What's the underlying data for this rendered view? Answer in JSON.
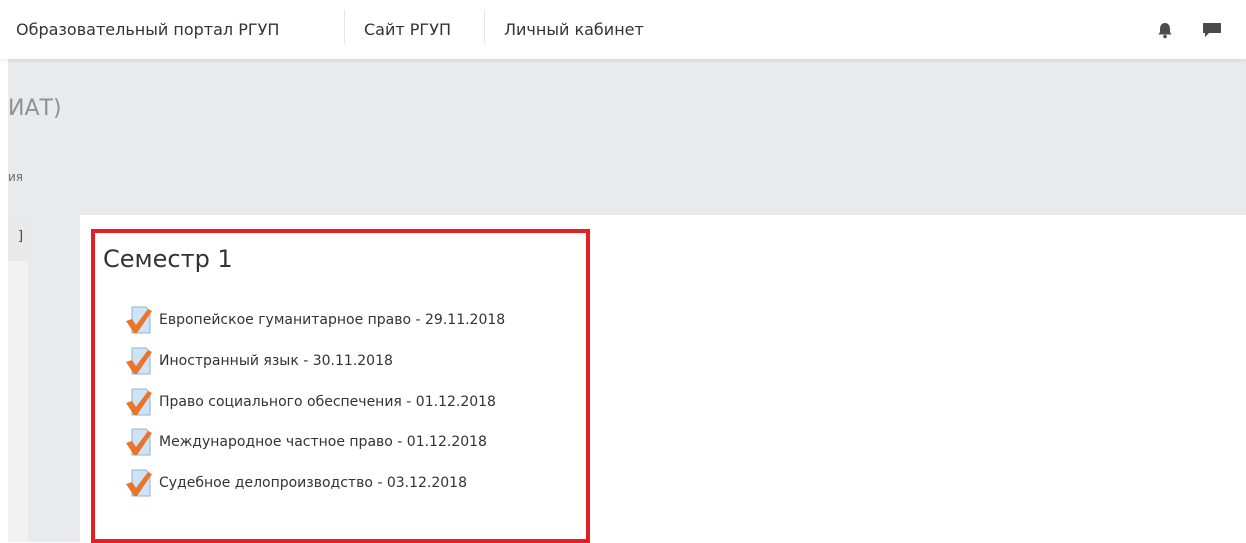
{
  "navbar": {
    "items": [
      {
        "label": "Образовательный портал РГУП"
      },
      {
        "label": "Сайт РГУП"
      },
      {
        "label": "Личный кабинет"
      }
    ],
    "icons": [
      "bell-icon",
      "chat-bubble-icon"
    ]
  },
  "header": {
    "title": "ИАТ)",
    "breadcrumb": "ия"
  },
  "left_panel": {
    "tab_glyph": "]"
  },
  "section": {
    "title": "Семестр 1",
    "activities": [
      {
        "label": "Европейское гуманитарное право - 29.11.2018"
      },
      {
        "label": "Иностранный язык - 30.11.2018"
      },
      {
        "label": "Право социального обеспечения - 01.12.2018"
      },
      {
        "label": "Международное частное право - 01.12.2018"
      },
      {
        "label": "Судебное делопроизводство - 03.12.2018"
      }
    ]
  },
  "colors": {
    "highlight_border": "#e31e24",
    "header_bg": "#e7ebee",
    "check_orange": "#e8752a",
    "doc_blue": "#cfe3f6"
  }
}
